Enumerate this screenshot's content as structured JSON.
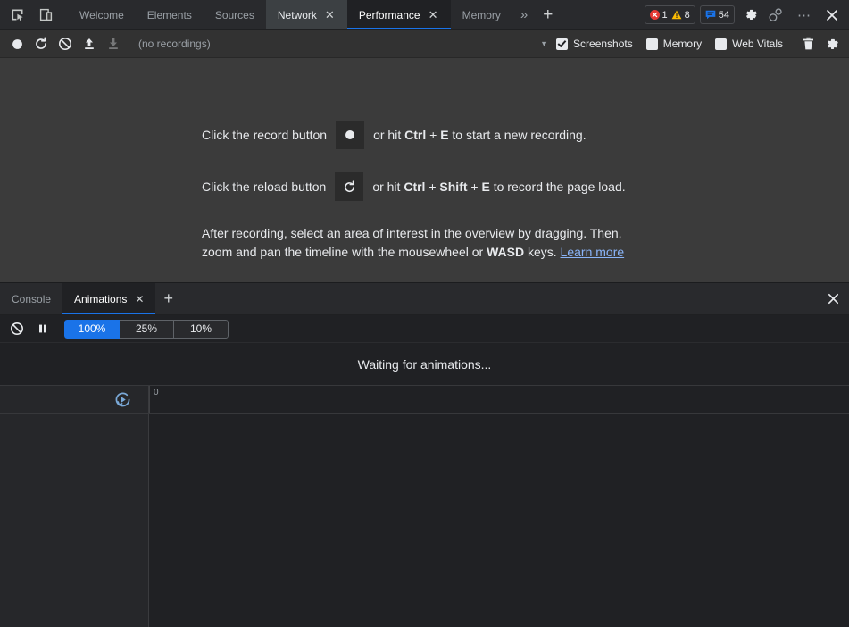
{
  "top_tabbar": {
    "inspect_icon": "inspect-cursor-icon",
    "device_icon": "device-toolbar-icon",
    "tabs": [
      {
        "label": "Welcome",
        "state": "inactive",
        "closable": false
      },
      {
        "label": "Elements",
        "state": "inactive",
        "closable": false
      },
      {
        "label": "Sources",
        "state": "inactive",
        "closable": false
      },
      {
        "label": "Network",
        "state": "hovered",
        "closable": true
      },
      {
        "label": "Performance",
        "state": "active",
        "closable": true
      },
      {
        "label": "Memory",
        "state": "inactive",
        "closable": false
      }
    ],
    "more_tabs_label": "»",
    "add_tab_label": "+",
    "errors_count": "1",
    "warnings_count": "8",
    "messages_count": "54",
    "settings_icon": "gear-icon",
    "customize_icon": "dock-settings-icon",
    "more_options_label": "⋯",
    "close_label": "✕",
    "accent_color": "#1a73e8"
  },
  "perf_toolbar": {
    "record_icon": "record-circle-icon",
    "reload_record_icon": "reload-record-icon",
    "clear_icon": "clear-prohibited-icon",
    "upload_icon": "load-profile-icon",
    "download_icon": "save-profile-icon",
    "recordings_label": "(no recordings)",
    "dropdown_caret": "▼",
    "checkboxes": [
      {
        "label": "Screenshots",
        "checked": true
      },
      {
        "label": "Memory",
        "checked": false
      },
      {
        "label": "Web Vitals",
        "checked": false
      }
    ],
    "trash_icon": "trash-icon",
    "settings_icon": "gear-icon"
  },
  "landing": {
    "row1_pre": "Click the record button",
    "row1_post_a": "or hit",
    "row1_key1": "Ctrl",
    "row1_plus": "+",
    "row1_key2": "E",
    "row1_post_b": "to start a new recording.",
    "row1_button_icon": "record-circle-icon",
    "row2_pre": "Click the reload button",
    "row2_post_a": "or hit",
    "row2_key1": "Ctrl",
    "row2_key2": "Shift",
    "row2_key3": "E",
    "row2_post_b": "to record the page load.",
    "row2_button_icon": "reload-record-icon",
    "para_a": "After recording, select an area of interest in the overview by dragging. Then, zoom and pan the timeline with the mousewheel or",
    "para_key": "WASD",
    "para_b": "keys.",
    "learn_more": "Learn more"
  },
  "drawer": {
    "tabs": [
      {
        "label": "Console",
        "state": "inactive",
        "closable": false
      },
      {
        "label": "Animations",
        "state": "active",
        "closable": true
      }
    ],
    "add_tab_label": "+",
    "close_label": "✕",
    "toolbar": {
      "clear_icon": "clear-prohibited-icon",
      "pause_icon": "pause-icon",
      "speed_options": [
        {
          "label": "100%",
          "selected": true
        },
        {
          "label": "25%",
          "selected": false
        },
        {
          "label": "10%",
          "selected": false
        }
      ]
    },
    "waiting_message": "Waiting for animations...",
    "timeline": {
      "replay_icon": "replay-icon",
      "tick_label": "0"
    }
  }
}
